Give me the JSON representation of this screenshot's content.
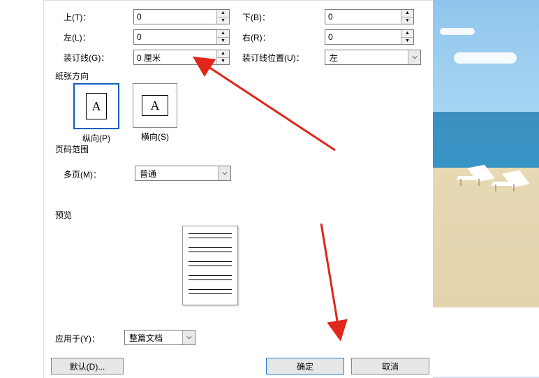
{
  "margins": {
    "top": {
      "label": "上(T)：",
      "value": "0"
    },
    "bottom": {
      "label": "下(B)：",
      "value": "0"
    },
    "left": {
      "label": "左(L)：",
      "value": "0"
    },
    "right": {
      "label": "右(R)：",
      "value": "0"
    },
    "gutter": {
      "label": "装订线(G)：",
      "value": "0 厘米"
    },
    "gutter_pos": {
      "label": "装订线位置(U)：",
      "value": "左"
    }
  },
  "orientation": {
    "section": "纸张方向",
    "portrait": {
      "label": "纵向(P)",
      "glyph": "A",
      "selected": true
    },
    "landscape": {
      "label": "横向(S)",
      "glyph": "A",
      "selected": false
    }
  },
  "page_range": {
    "section": "页码范围",
    "multi": {
      "label": "多页(M)：",
      "value": "普通"
    }
  },
  "preview": {
    "section": "预览"
  },
  "apply_to": {
    "label": "应用于(Y)：",
    "value": "整篇文档"
  },
  "buttons": {
    "default": "默认(D)...",
    "ok": "确定",
    "cancel": "取消"
  }
}
